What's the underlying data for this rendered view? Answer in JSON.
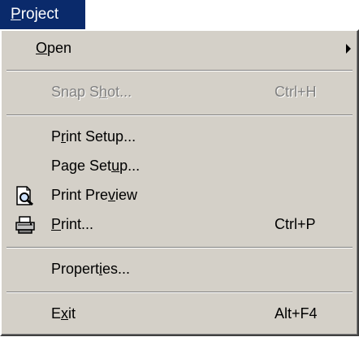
{
  "menu": {
    "title_prefix": "",
    "title_mnemonic": "P",
    "title_rest": "roject"
  },
  "items": {
    "open": {
      "pre": "",
      "mn": "O",
      "post": "pen"
    },
    "snapshot": {
      "pre": "Snap S",
      "mn": "h",
      "post": "ot...",
      "accel": "Ctrl+H"
    },
    "print_setup": {
      "pre": "P",
      "mn": "r",
      "post": "int Setup..."
    },
    "page_setup": {
      "pre": "Page Set",
      "mn": "u",
      "post": "p..."
    },
    "print_preview": {
      "pre": "Print Pre",
      "mn": "v",
      "post": "iew",
      "icon": "print-preview-icon"
    },
    "print": {
      "pre": "",
      "mn": "P",
      "post": "rint...",
      "accel": "Ctrl+P",
      "icon": "printer-icon"
    },
    "properties": {
      "pre": "Propert",
      "mn": "i",
      "post": "es..."
    },
    "exit": {
      "pre": "E",
      "mn": "x",
      "post": "it",
      "accel": "Alt+F4"
    }
  }
}
